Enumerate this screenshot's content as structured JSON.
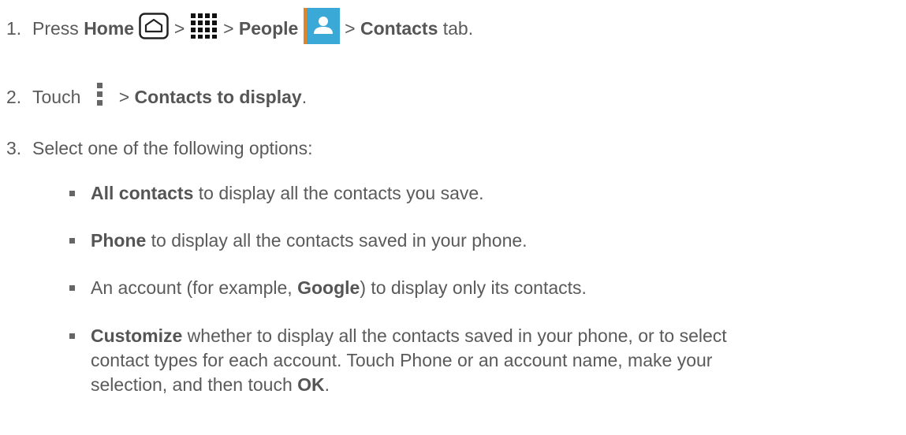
{
  "steps": [
    {
      "number": "1.",
      "press": "Press",
      "home": "Home",
      "sep1": ">",
      "sep2": ">",
      "people": "People",
      "sep3": ">",
      "contacts": "Contacts",
      "tab": "tab."
    },
    {
      "number": "2.",
      "touch": "Touch",
      "sep": ">",
      "contacts_to_display": "Contacts to display",
      "period": "."
    },
    {
      "number": "3.",
      "text": "Select one of the following options:"
    }
  ],
  "options": [
    {
      "bold": "All contacts",
      "rest": " to display all the contacts you save."
    },
    {
      "bold": "Phone",
      "rest": " to display all the contacts saved in your phone."
    },
    {
      "pre": "An account (for example, ",
      "bold": "Google",
      "rest": ") to display only its contacts."
    },
    {
      "bold": "Customize",
      "line1": " whether to display all the contacts saved in your phone, or to select",
      "line2": "contact types for each account. Touch Phone or an account name, make your",
      "line3": "selection, and then touch ",
      "ok": "OK",
      "end": "."
    }
  ],
  "icons": {
    "home": "home-button-icon",
    "apps": "apps-grid-icon",
    "people": "people-app-icon",
    "menu": "menu-dots-icon"
  },
  "colors": {
    "text": "#5a5a5a",
    "people_icon_bg": "#35a8d6"
  }
}
